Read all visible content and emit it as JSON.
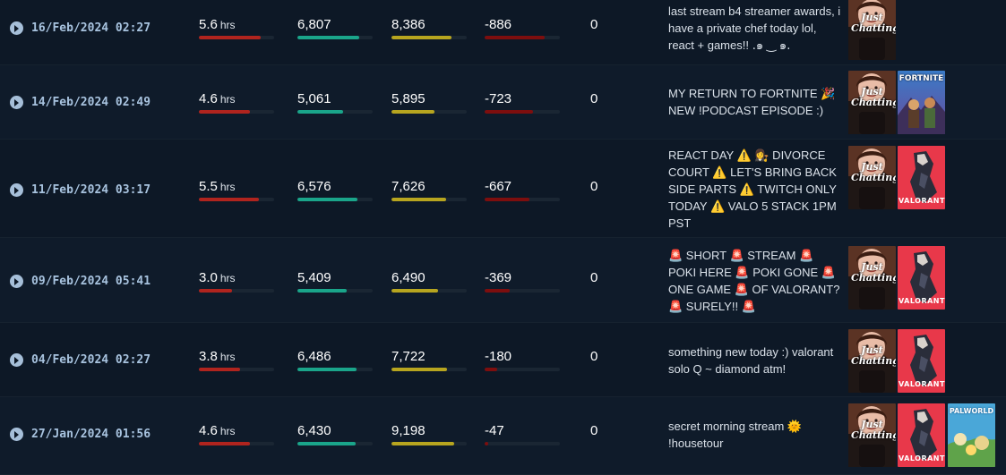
{
  "colors": {
    "background": "#0d1826",
    "duration_bar": "#b0241e",
    "avg_viewers_bar": "#1aa58a",
    "peak_viewers_bar": "#b7a51f",
    "followers_bar": "#7d0e0e"
  },
  "games": {
    "just_chatting": "Just Chatting",
    "fortnite": "FORTNITE",
    "valorant": "VALORANT",
    "palworld": "PALWORLD"
  },
  "streams": [
    {
      "date": "16/Feb/2024 02:27",
      "hours": "5.6",
      "hours_unit": "hrs",
      "hours_fill": 0.98,
      "avg_viewers": "6,807",
      "avg_fill": 0.98,
      "peak_viewers": "8,386",
      "peak_fill": 0.96,
      "followers": "-886",
      "followers_fill": 0.95,
      "subs": "0",
      "title": "last stream b4 streamer awards, i have a private chef today lol, react + games!! ․๑ ‿ ๑․",
      "games": [
        "just_chatting"
      ]
    },
    {
      "date": "14/Feb/2024 02:49",
      "hours": "4.6",
      "hours_unit": "hrs",
      "hours_fill": 0.81,
      "avg_viewers": "5,061",
      "avg_fill": 0.73,
      "peak_viewers": "5,895",
      "peak_fill": 0.68,
      "followers": "-723",
      "followers_fill": 0.77,
      "subs": "0",
      "title": "MY RETURN TO FORTNITE 🎉 NEW !PODCAST EPISODE :)",
      "games": [
        "just_chatting",
        "fortnite"
      ]
    },
    {
      "date": "11/Feb/2024 03:17",
      "hours": "5.5",
      "hours_unit": "hrs",
      "hours_fill": 0.96,
      "avg_viewers": "6,576",
      "avg_fill": 0.95,
      "peak_viewers": "7,626",
      "peak_fill": 0.87,
      "followers": "-667",
      "followers_fill": 0.72,
      "subs": "0",
      "title": "REACT DAY ⚠️ 👩‍⚖️ DIVORCE COURT ⚠️ LET'S BRING BACK SIDE PARTS ⚠️ TWITCH ONLY TODAY ⚠️ VALO 5 STACK 1PM PST",
      "games": [
        "just_chatting",
        "valorant"
      ]
    },
    {
      "date": "09/Feb/2024 05:41",
      "hours": "3.0",
      "hours_unit": "hrs",
      "hours_fill": 0.53,
      "avg_viewers": "5,409",
      "avg_fill": 0.78,
      "peak_viewers": "6,490",
      "peak_fill": 0.74,
      "followers": "-369",
      "followers_fill": 0.4,
      "subs": "0",
      "title": "🚨 SHORT 🚨 STREAM 🚨 POKI HERE 🚨 POKI GONE 🚨 ONE GAME 🚨 OF VALORANT? 🚨 SURELY!! 🚨",
      "games": [
        "just_chatting",
        "valorant"
      ]
    },
    {
      "date": "04/Feb/2024 02:27",
      "hours": "3.8",
      "hours_unit": "hrs",
      "hours_fill": 0.66,
      "avg_viewers": "6,486",
      "avg_fill": 0.94,
      "peak_viewers": "7,722",
      "peak_fill": 0.89,
      "followers": "-180",
      "followers_fill": 0.2,
      "subs": "0",
      "title": "something new today :) valorant solo Q ~ diamond atm!",
      "games": [
        "just_chatting",
        "valorant"
      ]
    },
    {
      "date": "27/Jan/2024 01:56",
      "hours": "4.6",
      "hours_unit": "hrs",
      "hours_fill": 0.81,
      "avg_viewers": "6,430",
      "avg_fill": 0.93,
      "peak_viewers": "9,198",
      "peak_fill": 1.0,
      "followers": "-47",
      "followers_fill": 0.06,
      "subs": "0",
      "title": "secret morning stream 🌞 !housetour",
      "games": [
        "just_chatting",
        "valorant",
        "palworld"
      ]
    }
  ]
}
